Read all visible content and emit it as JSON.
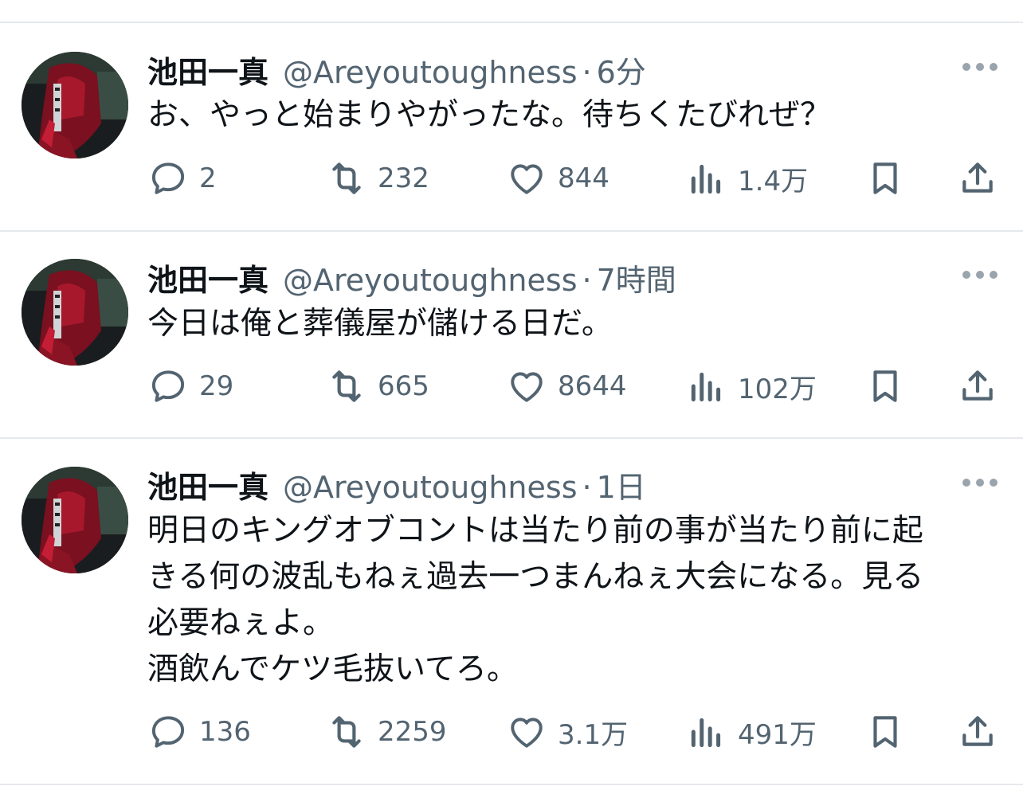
{
  "tweets": [
    {
      "name": "池田一真",
      "handle": "@Areyoutoughness",
      "sep": "·",
      "time": "6分",
      "text": "お、やっと始まりやがったな。待ちくたびれぜ？",
      "replies": "2",
      "retweets": "232",
      "likes": "844",
      "views": "1.4万"
    },
    {
      "name": "池田一真",
      "handle": "@Areyoutoughness",
      "sep": "·",
      "time": "7時間",
      "text": "今日は俺と葬儀屋が儲ける日だ。",
      "replies": "29",
      "retweets": "665",
      "likes": "8644",
      "views": "102万"
    },
    {
      "name": "池田一真",
      "handle": "@Areyoutoughness",
      "sep": "·",
      "time": "1日",
      "text": "明日のキングオブコントは当たり前の事が当たり前に起\nきる何の波乱もねぇ過去一つまんねぇ大会になる。見る\n必要ねぇよ。\n酒飲んでケツ毛抜いてろ。",
      "replies": "136",
      "retweets": "2259",
      "likes": "3.1万",
      "views": "491万"
    }
  ],
  "icons": {
    "reply": "reply-icon",
    "retweet": "retweet-icon",
    "like": "heart-icon",
    "views": "views-icon",
    "bookmark": "bookmark-icon",
    "share": "share-icon",
    "more": "more-icon"
  },
  "colors": {
    "text": "#0f1419",
    "secondary": "#536471",
    "divider": "#e6e9ec"
  }
}
